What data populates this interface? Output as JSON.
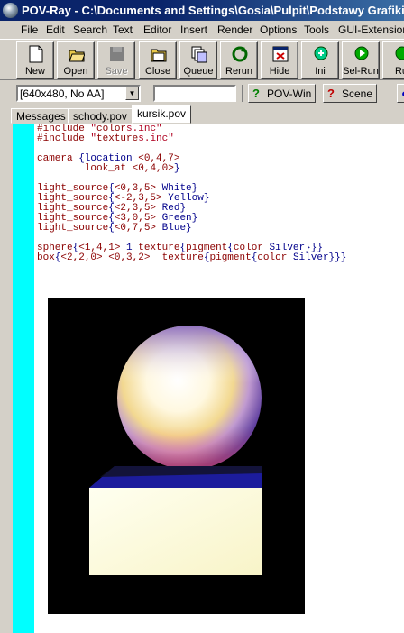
{
  "window": {
    "title": "POV-Ray - C:\\Documents and Settings\\Gosia\\Pulpit\\Podstawy Grafiki"
  },
  "menu": [
    {
      "label": "File",
      "name": "menu-file"
    },
    {
      "label": "Edit",
      "name": "menu-edit"
    },
    {
      "label": "Search",
      "name": "menu-search"
    },
    {
      "label": "Text",
      "name": "menu-text"
    },
    {
      "label": "Editor",
      "name": "menu-editor"
    },
    {
      "label": "Insert",
      "name": "menu-insert"
    },
    {
      "label": "Render",
      "name": "menu-render"
    },
    {
      "label": "Options",
      "name": "menu-options"
    },
    {
      "label": "Tools",
      "name": "menu-tools"
    },
    {
      "label": "GUI-Extensions",
      "name": "menu-gui-extensions"
    }
  ],
  "toolbar": {
    "new": "New",
    "open": "Open",
    "save": "Save",
    "close": "Close",
    "queue": "Queue",
    "rerun": "Rerun",
    "hide": "Hide",
    "ini": "Ini",
    "selrun": "Sel-Run",
    "run": "Ru"
  },
  "toolbar2": {
    "resolution": "[640x480, No AA]",
    "command_line": "",
    "povwin_help": "POV-Win",
    "scene_help": "Scene"
  },
  "tabs": [
    {
      "label": "Messages",
      "active": false
    },
    {
      "label": "schody.pov",
      "active": false
    },
    {
      "label": "kursik.pov",
      "active": true
    }
  ],
  "code_lines": [
    "#include \"colors.inc\"",
    "#include \"textures.inc\"",
    "",
    "camera {location <0,4,7>",
    "        look_at <0,4,0>}",
    "",
    "light_source{<0,3,5> White}",
    "light_source{<-2,3,5> Yellow}",
    "light_source{<2,3,5> Red}",
    "light_source{<3,0,5> Green}",
    "light_source{<0,7,5> Blue}",
    "",
    "sphere{<1,4,1> 1 texture{pigment{color Silver}}}",
    "box{<2,2,0> <0,3,2>  texture{pigment{color Silver}}}"
  ],
  "colors": {
    "gutter": "#00ffff",
    "titlebar": "#0a246a",
    "chrome": "#d4d0c8"
  }
}
